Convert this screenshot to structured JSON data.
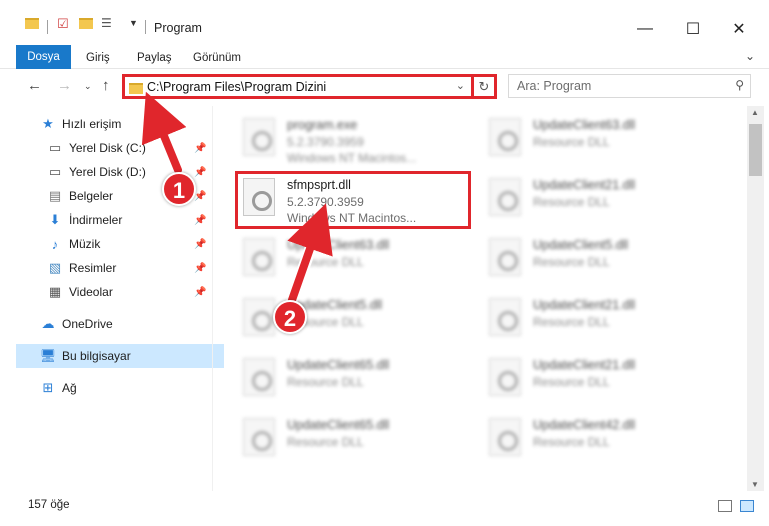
{
  "window": {
    "title": "Program",
    "controls": {
      "minimize": "—",
      "maximize": "☐",
      "close": "✕"
    }
  },
  "ribbon": {
    "tabs": [
      {
        "label": "Dosya"
      },
      {
        "label": "Giriş"
      },
      {
        "label": "Paylaş"
      },
      {
        "label": "Görünüm"
      }
    ]
  },
  "address": {
    "path": "C:\\Program Files\\Program Dizini",
    "search_placeholder": "Ara: Program"
  },
  "sidebar": {
    "items": [
      {
        "label": "Hızlı erişim",
        "icon": "star-icon"
      },
      {
        "label": "Yerel Disk (C:)",
        "icon": "drive-icon",
        "pinned": true
      },
      {
        "label": "Yerel Disk (D:)",
        "icon": "drive-icon",
        "pinned": true
      },
      {
        "label": "Belgeler",
        "icon": "document-icon",
        "pinned": true
      },
      {
        "label": "İndirmeler",
        "icon": "download-icon",
        "pinned": true
      },
      {
        "label": "Müzik",
        "icon": "music-icon",
        "pinned": true
      },
      {
        "label": "Resimler",
        "icon": "pictures-icon",
        "pinned": true
      },
      {
        "label": "Videolar",
        "icon": "video-icon",
        "pinned": true
      },
      {
        "label": "OneDrive",
        "icon": "cloud-icon"
      },
      {
        "label": "Bu bilgisayar",
        "icon": "computer-icon",
        "selected": true
      },
      {
        "label": "Ağ",
        "icon": "network-icon"
      }
    ]
  },
  "files": [
    {
      "name": "program.exe",
      "line2": "5.2.3790.3959",
      "line3": "Windows NT Macintos...",
      "blurred": true
    },
    {
      "name": "UpdateClient63.dll",
      "line2": "Resource DLL",
      "line3": "",
      "blurred": true
    },
    {
      "name": "sfmpsprt.dll",
      "line2": "5.2.3790.3959",
      "line3": "Windows NT Macintos...",
      "blurred": false
    },
    {
      "name": "UpdateClient21.dll",
      "line2": "Resource DLL",
      "line3": "",
      "blurred": true
    },
    {
      "name": "UpdateClient63.dll",
      "line2": "Resource DLL",
      "line3": "",
      "blurred": true
    },
    {
      "name": "UpdateClient5.dll",
      "line2": "Resource DLL",
      "line3": "",
      "blurred": true
    },
    {
      "name": "UpdateClient5.dll",
      "line2": "Resource DLL",
      "line3": "",
      "blurred": true
    },
    {
      "name": "UpdateClient21.dll",
      "line2": "Resource DLL",
      "line3": "",
      "blurred": true
    },
    {
      "name": "UpdateClient65.dll",
      "line2": "Resource DLL",
      "line3": "",
      "blurred": true
    },
    {
      "name": "UpdateClient21.dll",
      "line2": "Resource DLL",
      "line3": "",
      "blurred": true
    },
    {
      "name": "UpdateClient65.dll",
      "line2": "Resource DLL",
      "line3": "",
      "blurred": true
    },
    {
      "name": "UpdateClient42.dll",
      "line2": "Resource DLL",
      "line3": "",
      "blurred": true
    }
  ],
  "status": {
    "count_text": "157 öğe"
  },
  "callouts": {
    "one": "1",
    "two": "2"
  },
  "colors": {
    "accent": "#1979ca",
    "highlight": "#e0262c",
    "selection": "#cce8ff"
  }
}
